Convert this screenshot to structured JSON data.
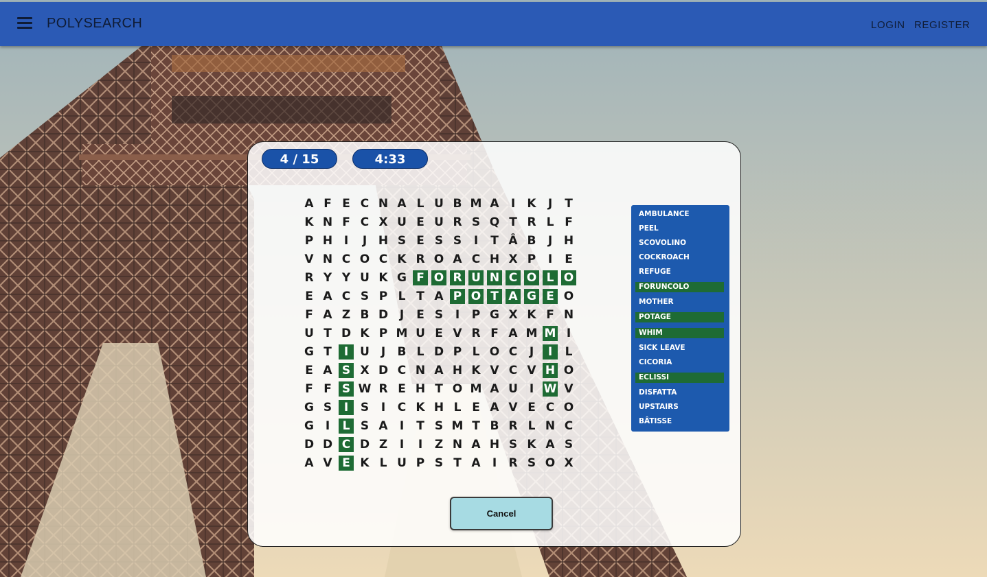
{
  "header": {
    "title": "POLYSEARCH",
    "menu_icon": "hamburger-menu-icon",
    "login_label": "LOGIN",
    "register_label": "REGISTER",
    "bar_color": "#2b5ab5"
  },
  "game": {
    "progress": "4 / 15",
    "timer": "4:33",
    "cancel_label": "Cancel",
    "grid": [
      "AFECNALUBMAIKJT",
      "KNFCXUEURSQTRLF",
      "PHIJHSESSITÂBJH",
      "VNCOCKROACHXPIE",
      "RYYUKGFORUNCOLO",
      "EACSPLTAPOTAGEO",
      "FAZBDJESIPGXKFN",
      "UTDKPMUEVRFAMMI",
      "GTIUJBLDPLOCJIL",
      "EASXDCNAHKVCVHO",
      "FFSWREHTOMAUIWV",
      "GSISICKHLEAVECO",
      "GILSAITSMTBRLNC",
      "DDCDZIIZNAHSKAS",
      "AVEKLUPSTAIRSOX"
    ],
    "found_paths": [
      {
        "word": "FORUNCOLO",
        "row": 4,
        "col": 6,
        "dr": 0,
        "dc": 1,
        "len": 9
      },
      {
        "word": "POTAGE",
        "row": 5,
        "col": 8,
        "dr": 0,
        "dc": 1,
        "len": 6
      },
      {
        "word": "WHIM",
        "row": 10,
        "col": 13,
        "dr": -1,
        "dc": 0,
        "len": 4
      },
      {
        "word": "ECLISSI",
        "row": 14,
        "col": 2,
        "dr": -1,
        "dc": 0,
        "len": 7
      }
    ],
    "words": [
      {
        "label": "AMBULANCE",
        "found": false
      },
      {
        "label": "PEEL",
        "found": false
      },
      {
        "label": "SCOVOLINO",
        "found": false
      },
      {
        "label": "COCKROACH",
        "found": false
      },
      {
        "label": "REFUGE",
        "found": false
      },
      {
        "label": "FORUNCOLO",
        "found": true
      },
      {
        "label": "MOTHER",
        "found": false
      },
      {
        "label": "POTAGE",
        "found": true
      },
      {
        "label": "WHIM",
        "found": true
      },
      {
        "label": "SICK LEAVE",
        "found": false
      },
      {
        "label": "CICORIA",
        "found": false
      },
      {
        "label": "ECLISSI",
        "found": true
      },
      {
        "label": "DISFATTA",
        "found": false
      },
      {
        "label": "UPSTAIRS",
        "found": false
      },
      {
        "label": "BÂTISSE",
        "found": false
      }
    ],
    "colors": {
      "found": "#1e6b34",
      "pill": "#1a52a8",
      "word_list": "#1d5aae",
      "cancel": "#a7dbe3"
    }
  }
}
